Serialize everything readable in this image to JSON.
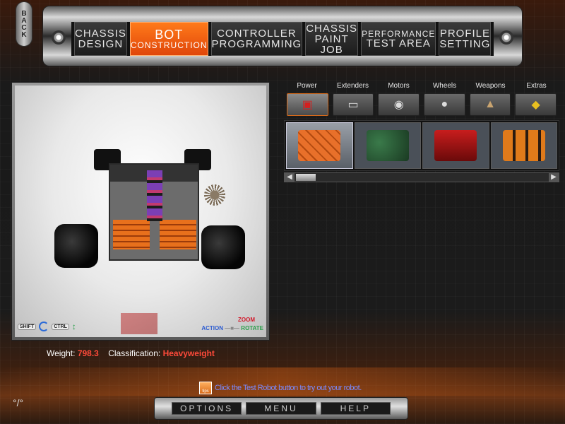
{
  "header": {
    "back_label": "BACK",
    "tabs": [
      {
        "line1": "CHASSIS",
        "line2": "DESIGN"
      },
      {
        "line1": "BOT",
        "line2": "CONSTRUCTION"
      },
      {
        "line1": "CONTROLLER",
        "line2": "PROGRAMMING"
      },
      {
        "line1": "CHASSIS",
        "line2": "PAINT JOB"
      },
      {
        "line1": "PERFORMANCE",
        "line2": "TEST AREA"
      },
      {
        "line1": "PROFILE",
        "line2": "SETTING"
      }
    ],
    "active_tab_index": 1
  },
  "viewport": {
    "hints": {
      "shift_key": "SHIFT",
      "ctrl_key": "CTRL",
      "zoom": "ZOOM",
      "action": "ACTION",
      "rotate": "ROTATE"
    }
  },
  "stats": {
    "weight_label": "Weight:",
    "weight_value": "798.3",
    "class_label": "Classification:",
    "class_value": "Heavyweight"
  },
  "parts_panel": {
    "categories": [
      "Power",
      "Extenders",
      "Motors",
      "Wheels",
      "Weapons",
      "Extras"
    ],
    "category_icons": [
      "battery-icon",
      "extender-bar-icon",
      "motor-icon",
      "wheel-icon",
      "weapon-icon",
      "extras-icon"
    ],
    "active_category_index": 0,
    "parts": [
      "orange-battery-part",
      "green-circuit-part",
      "red-battery-part",
      "orange-battery-pack-part"
    ],
    "selected_part_index": 0
  },
  "tip": {
    "icon_text": "tips",
    "text": "Click the Test Robot button to try out your robot."
  },
  "bottom_nav": {
    "options": "OPTIONS",
    "menu": "MENU",
    "help": "HELP"
  },
  "corner": {
    "logo": "°/°"
  },
  "colors": {
    "accent": "#e0460a",
    "value_red": "#ff4a3a",
    "tip_text": "#7a8aff"
  }
}
